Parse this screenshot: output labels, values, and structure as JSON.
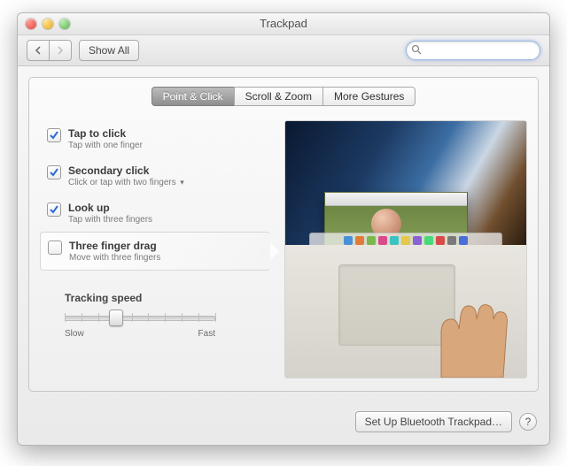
{
  "window": {
    "title": "Trackpad"
  },
  "toolbar": {
    "show_all": "Show All",
    "search_placeholder": ""
  },
  "tabs": [
    {
      "label": "Point & Click",
      "selected": true
    },
    {
      "label": "Scroll & Zoom",
      "selected": false
    },
    {
      "label": "More Gestures",
      "selected": false
    }
  ],
  "options": [
    {
      "label": "Tap to click",
      "sub": "Tap with one finger",
      "checked": true,
      "dropdown": false,
      "selected": false
    },
    {
      "label": "Secondary click",
      "sub": "Click or tap with two fingers",
      "checked": true,
      "dropdown": true,
      "selected": false
    },
    {
      "label": "Look up",
      "sub": "Tap with three fingers",
      "checked": true,
      "dropdown": false,
      "selected": false
    },
    {
      "label": "Three finger drag",
      "sub": "Move with three fingers",
      "checked": false,
      "dropdown": false,
      "selected": true
    }
  ],
  "tracking": {
    "label": "Tracking speed",
    "min_label": "Slow",
    "max_label": "Fast",
    "steps": 10,
    "value_index": 3
  },
  "footer": {
    "bluetooth": "Set Up Bluetooth Trackpad…",
    "help": "?"
  },
  "dock_colors": [
    "#4a90d9",
    "#e07b3c",
    "#7ab84c",
    "#d94a8b",
    "#3cc2c2",
    "#e6c84a",
    "#8a62d1",
    "#4ad97a",
    "#d94a4a",
    "#7a7a7a",
    "#4a6ed9"
  ]
}
